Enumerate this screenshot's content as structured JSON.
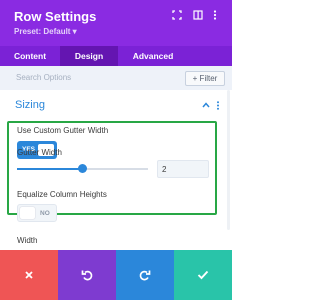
{
  "header": {
    "title": "Row Settings",
    "preset": "Preset: Default ▾",
    "icons": [
      "expand-icon",
      "sidebar-toggle-icon",
      "more-options-icon"
    ]
  },
  "tabs": [
    {
      "label": "Content",
      "active": false
    },
    {
      "label": "Design",
      "active": true
    },
    {
      "label": "Advanced",
      "active": false
    }
  ],
  "search": {
    "placeholder": "Search Options",
    "filter_label": "+ Filter"
  },
  "section": {
    "title": "Sizing"
  },
  "fields": {
    "custom_gutter": {
      "label": "Use Custom Gutter Width",
      "state": "YES"
    },
    "gutter_width": {
      "label": "Gutter Width",
      "value": "2",
      "slider_fraction": 0.5
    },
    "equalize": {
      "label": "Equalize Column Heights",
      "state": "NO"
    },
    "width": {
      "label": "Width"
    }
  },
  "footer": {
    "colors": {
      "cancel": "#ef5555",
      "undo": "#7e3bd0",
      "redo": "#2b87da",
      "save": "#29c4a9"
    }
  },
  "colors": {
    "header": "#8a2be2",
    "accent": "#2b87da",
    "highlight": "#28a745"
  }
}
